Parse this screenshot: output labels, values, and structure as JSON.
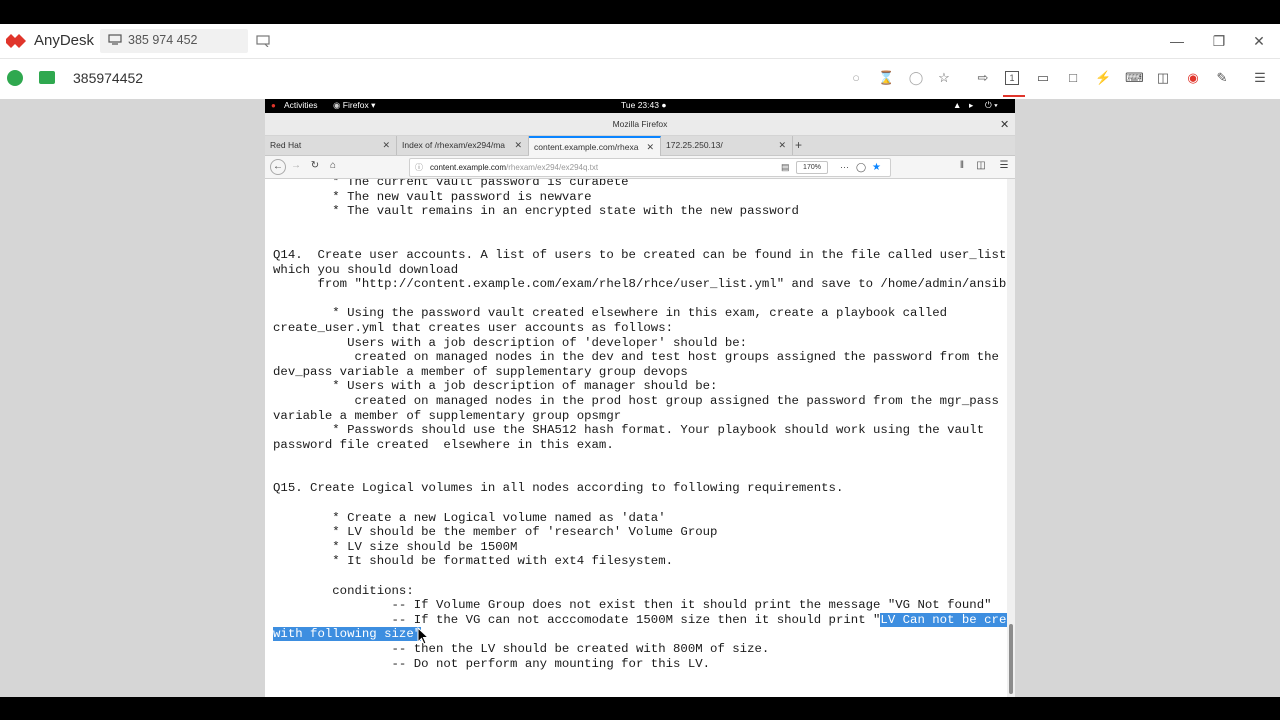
{
  "anydesk": {
    "app_name": "AnyDesk",
    "session_tab_label": "385 974 452",
    "remote_id": "385974452",
    "colors": {
      "brand": "#e0352b",
      "ok": "#2fa84f"
    }
  },
  "gnome": {
    "activities": "Activities",
    "app_menu": "Firefox",
    "clock": "Tue 23:43"
  },
  "firefox": {
    "window_title": "Mozilla Firefox",
    "tabs": [
      {
        "label": "Red Hat",
        "active": false
      },
      {
        "label": "Index of /rhexam/ex294/ma",
        "active": false
      },
      {
        "label": "content.example.com/rhexa",
        "active": true
      },
      {
        "label": "172.25.250.13/",
        "active": false
      }
    ],
    "url_host": "content.example.com",
    "url_path": "/rhexam/ex294/ex294q.txt",
    "zoom": "170%"
  },
  "doc": {
    "lines_before": "        * The current vault password is curabete\n        * The new vault password is newvare\n        * The vault remains in an encrypted state with the new password\n\n\nQ14.  Create user accounts. A list of users to be created can be found in the file called user_list.yml\nwhich you should download\n      from \"http://content.example.com/exam/rhel8/rhce/user_list.yml\" and save to /home/admin/ansible/\n\n        * Using the password vault created elsewhere in this exam, create a playbook called\ncreate_user.yml that creates user accounts as follows:\n          Users with a job description of 'developer' should be:\n           created on managed nodes in the dev and test host groups assigned the password from the\ndev_pass variable a member of supplementary group devops\n        * Users with a job description of manager should be:\n           created on managed nodes in the prod host group assigned the password from the mgr_pass\nvariable a member of supplementary group opsmgr\n        * Passwords should use the SHA512 hash format. Your playbook should work using the vault\npassword file created  elsewhere in this exam.\n\n\nQ15. Create Logical volumes in all nodes according to following requirements.\n\n        * Create a new Logical volume named as 'data'\n        * LV should be the member of 'research' Volume Group\n        * LV size should be 1500M\n        * It should be formatted with ext4 filesystem.\n\n        conditions:\n                -- If Volume Group does not exist then it should print the message \"VG Not found\"\n                -- If the VG can not acccomodate 1500M size then it should print \"",
    "selected_1": "LV Can not be created ",
    "selected_2": "with following size\"",
    "lines_after": "\n                -- then the LV should be created with 800M of size.\n                -- Do not perform any mounting for this LV."
  }
}
